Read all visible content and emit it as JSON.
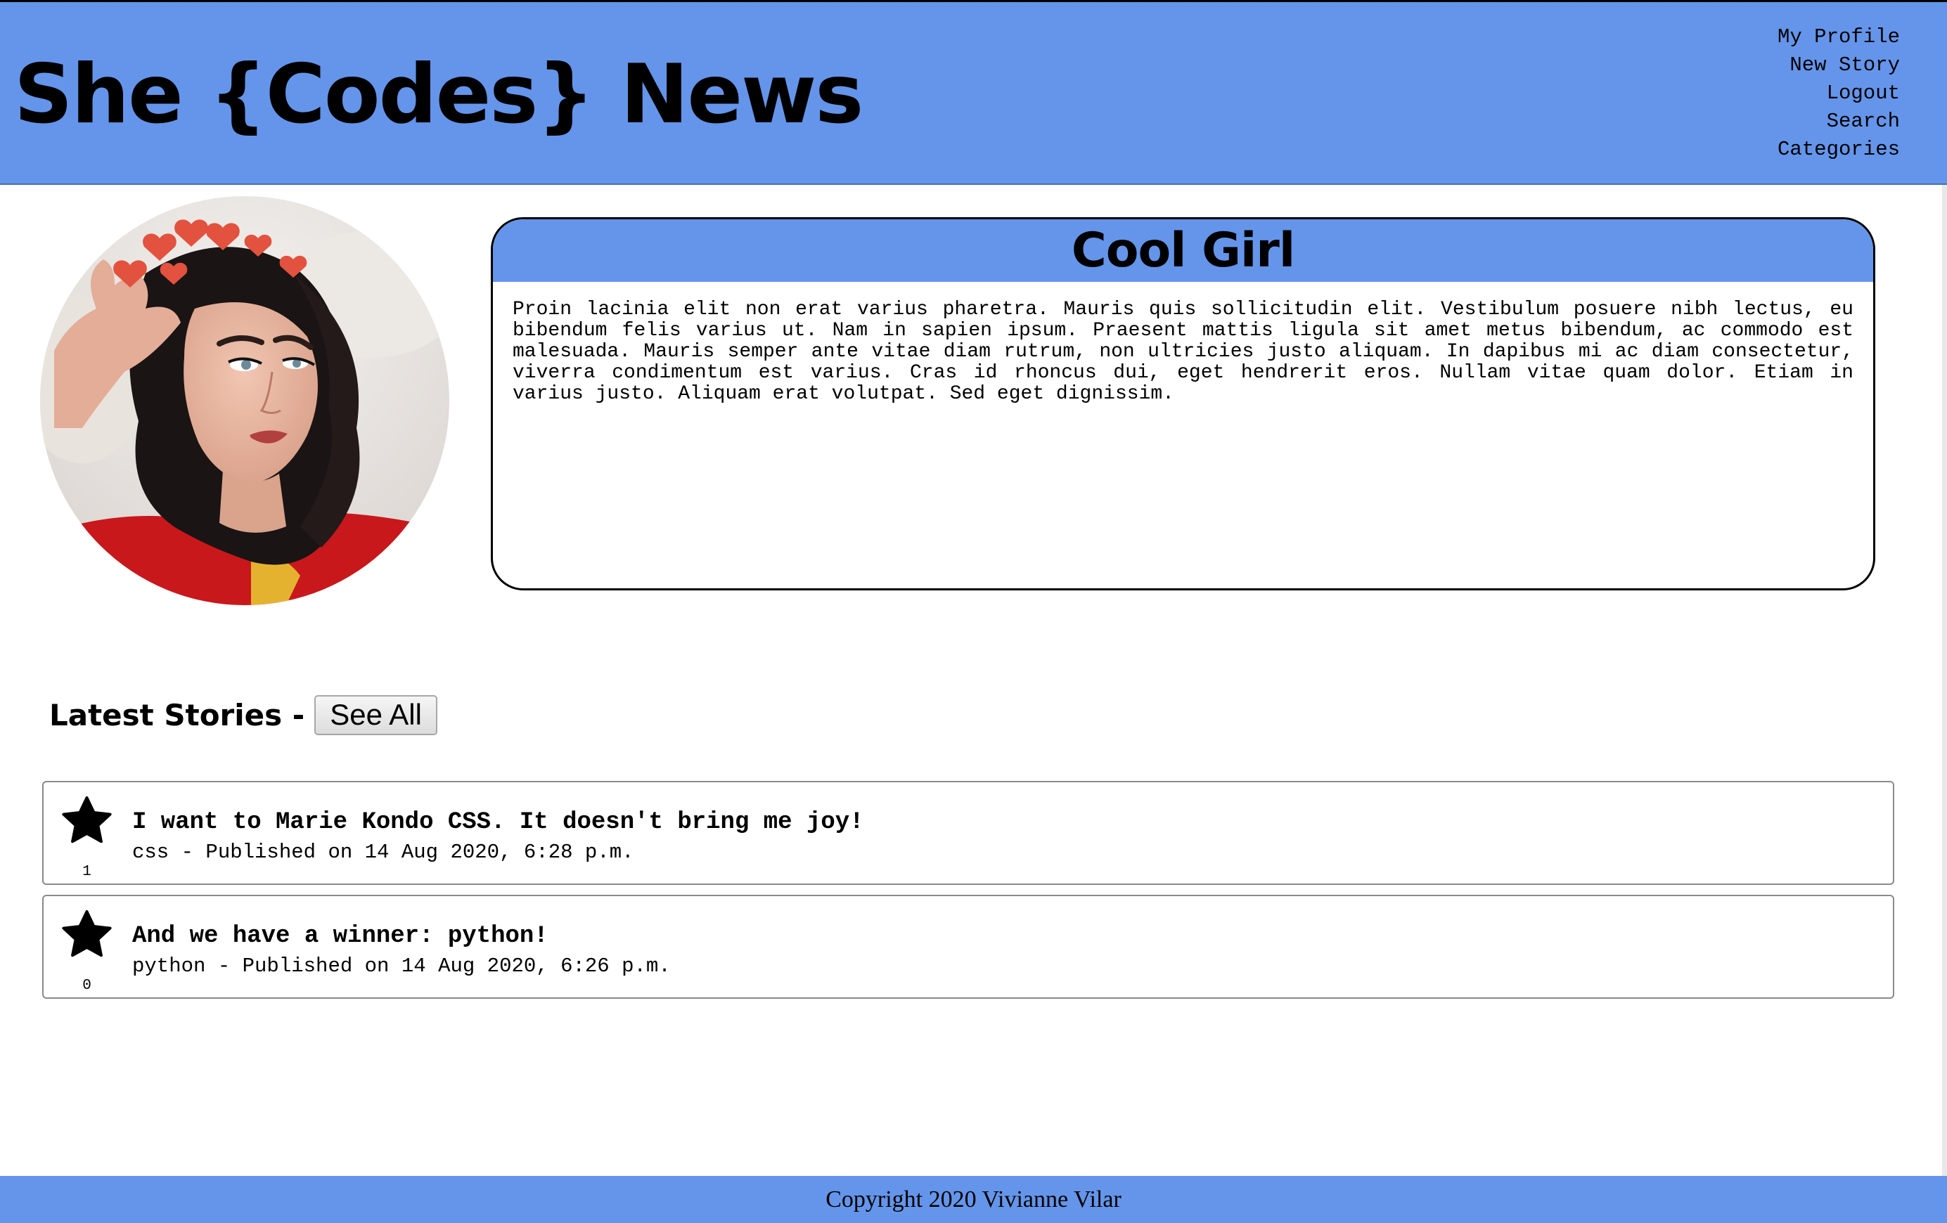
{
  "header": {
    "site_title": "She {Codes} News",
    "nav": [
      "My Profile",
      "New Story",
      "Logout",
      "Search",
      "Categories"
    ]
  },
  "profile": {
    "name": "Cool Girl",
    "bio": "Proin lacinia elit non erat varius pharetra. Mauris quis sollicitudin elit. Vestibulum posuere nibh lectus, eu bibendum felis varius ut. Nam in sapien ipsum. Praesent mattis ligula sit amet metus bibendum, ac commodo est malesuada. Mauris semper ante vitae diam rutrum, non ultricies justo aliquam. In dapibus mi ac diam consectetur, viverra condimentum est varius. Cras id rhoncus dui, eget hendrerit eros. Nullam vitae quam dolor. Etiam in varius justo. Aliquam erat volutpat. Sed eget dignissim."
  },
  "latest": {
    "title": "Latest Stories -",
    "see_all_label": "See All"
  },
  "stories": [
    {
      "title": "I want to Marie Kondo CSS. It doesn't bring me joy!",
      "meta": "css - Published on 14 Aug 2020, 6:28 p.m.",
      "likes": "1"
    },
    {
      "title": "And we have a winner: python!",
      "meta": "python - Published on 14 Aug 2020, 6:26 p.m.",
      "likes": "0"
    }
  ],
  "footer": {
    "copyright": "Copyright 2020 Vivianne Vilar"
  },
  "colors": {
    "accent": "#6495ea",
    "text": "#000000"
  }
}
